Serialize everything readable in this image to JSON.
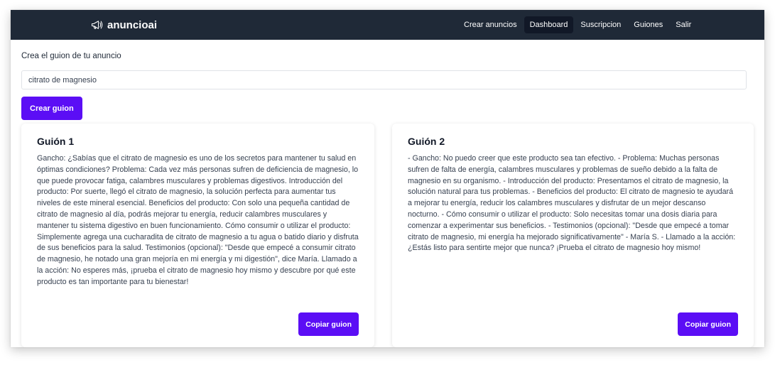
{
  "brand": {
    "name": "anuncioai",
    "icon": "megaphone-icon"
  },
  "nav": {
    "items": [
      {
        "label": "Crear anuncios",
        "active": false
      },
      {
        "label": "Dashboard",
        "active": true
      },
      {
        "label": "Suscripcion",
        "active": false
      },
      {
        "label": "Guiones",
        "active": false
      },
      {
        "label": "Salir",
        "active": false
      }
    ]
  },
  "form": {
    "label": "Crea el guion de tu anuncio",
    "input_value": "citrato de magnesio",
    "button_label": "Crear guion"
  },
  "scripts": [
    {
      "title": "Guión 1",
      "body": "Gancho: ¿Sabías que el citrato de magnesio es uno de los secretos para mantener tu salud en óptimas condiciones? Problema: Cada vez más personas sufren de deficiencia de magnesio, lo que puede provocar fatiga, calambres musculares y problemas digestivos. Introducción del producto: Por suerte, llegó el citrato de magnesio, la solución perfecta para aumentar tus niveles de este mineral esencial. Beneficios del producto: Con solo una pequeña cantidad de citrato de magnesio al día, podrás mejorar tu energía, reducir calambres musculares y mantener tu sistema digestivo en buen funcionamiento. Cómo consumir o utilizar el producto: Simplemente agrega una cucharadita de citrato de magnesio a tu agua o batido diario y disfruta de sus beneficios para la salud. Testimonios (opcional): \"Desde que empecé a consumir citrato de magnesio, he notado una gran mejoría en mi energía y mi digestión\", dice María. Llamado a la acción: No esperes más, ¡prueba el citrato de magnesio hoy mismo y descubre por qué este producto es tan importante para tu bienestar!",
      "copy_label": "Copiar guion"
    },
    {
      "title": "Guión 2",
      "body": "- Gancho: No puedo creer que este producto sea tan efectivo. - Problema: Muchas personas sufren de falta de energía, calambres musculares y problemas de sueño debido a la falta de magnesio en su organismo. - Introducción del producto: Presentamos el citrato de magnesio, la solución natural para tus problemas. - Beneficios del producto: El citrato de magnesio te ayudará a mejorar tu energía, reducir los calambres musculares y disfrutar de un mejor descanso nocturno. - Cómo consumir o utilizar el producto: Solo necesitas tomar una dosis diaria para comenzar a experimentar sus beneficios. - Testimonios (opcional): \"Desde que empecé a tomar citrato de magnesio, mi energía ha mejorado significativamente\" - María S. - Llamado a la acción: ¿Estás listo para sentirte mejor que nunca? ¡Prueba el citrato de magnesio hoy mismo!",
      "copy_label": "Copiar guion"
    }
  ],
  "colors": {
    "navbar": "#1f2937",
    "primary_button": "#5b0ef5"
  }
}
